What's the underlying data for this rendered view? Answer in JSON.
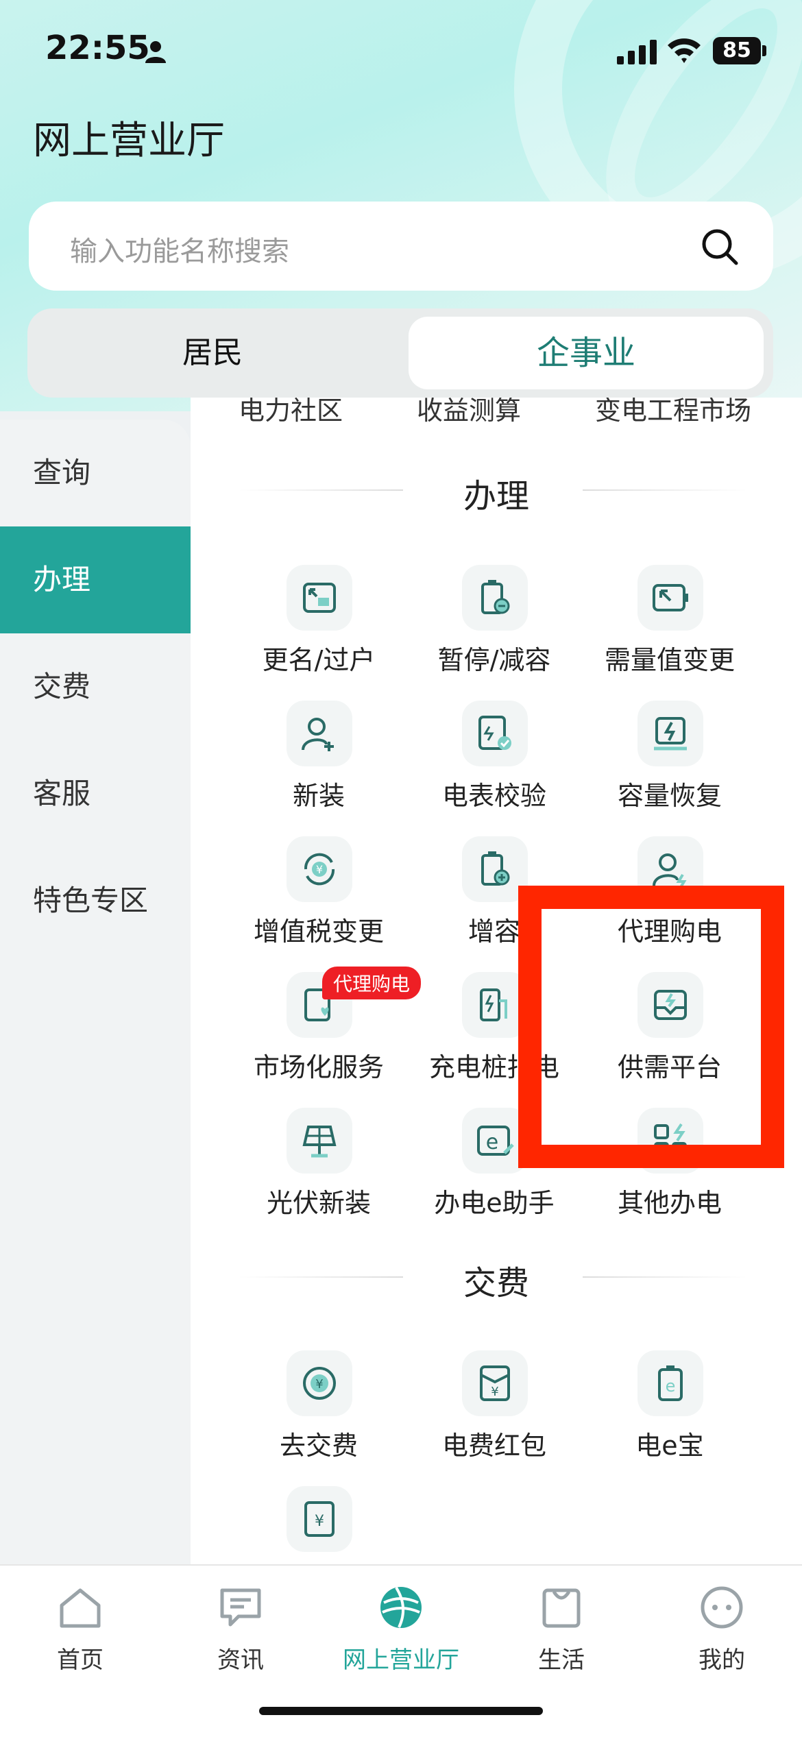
{
  "status": {
    "time": "22:55",
    "battery": "85"
  },
  "header": {
    "title": "网上营业厅"
  },
  "search": {
    "placeholder": "输入功能名称搜索"
  },
  "segment": {
    "left": "居民",
    "right": "企事业"
  },
  "sidebar": {
    "items": [
      {
        "label": "查询"
      },
      {
        "label": "办理"
      },
      {
        "label": "交费"
      },
      {
        "label": "客服"
      },
      {
        "label": "特色专区"
      }
    ],
    "active": "办理"
  },
  "content": {
    "cut_row": [
      "电力社区",
      "收益测算",
      "变电工程市场"
    ],
    "sections": [
      {
        "title": "办理",
        "items": [
          {
            "label": "更名/过户",
            "icon": "transfer-icon"
          },
          {
            "label": "暂停/减容",
            "icon": "pause-battery-icon"
          },
          {
            "label": "需量值变更",
            "icon": "demand-change-icon"
          },
          {
            "label": "新装",
            "icon": "new-user-icon"
          },
          {
            "label": "电表校验",
            "icon": "meter-check-icon"
          },
          {
            "label": "容量恢复",
            "icon": "capacity-restore-icon"
          },
          {
            "label": "增值税变更",
            "icon": "vat-change-icon"
          },
          {
            "label": "增容",
            "icon": "capacity-add-icon"
          },
          {
            "label": "代理购电",
            "icon": "proxy-purchase-icon"
          },
          {
            "label": "市场化服务",
            "icon": "market-service-icon",
            "badge": "代理购电"
          },
          {
            "label": "充电桩报电",
            "icon": "charging-pile-icon"
          },
          {
            "label": "供需平台",
            "icon": "supply-demand-icon"
          },
          {
            "label": "光伏新装",
            "icon": "solar-panel-icon"
          },
          {
            "label": "办电e助手",
            "icon": "e-assistant-icon"
          },
          {
            "label": "其他办电",
            "icon": "other-service-icon"
          }
        ]
      },
      {
        "title": "交费",
        "items": [
          {
            "label": "去交费",
            "icon": "yuan-coin-icon"
          },
          {
            "label": "电费红包",
            "icon": "red-packet-icon"
          },
          {
            "label": "电e宝",
            "icon": "e-wallet-icon"
          }
        ]
      }
    ]
  },
  "tabbar": {
    "items": [
      {
        "label": "首页",
        "icon": "home-icon"
      },
      {
        "label": "资讯",
        "icon": "news-icon"
      },
      {
        "label": "网上营业厅",
        "icon": "globe-icon"
      },
      {
        "label": "生活",
        "icon": "shopping-bag-icon"
      },
      {
        "label": "我的",
        "icon": "face-icon"
      }
    ],
    "active": "网上营业厅"
  },
  "colors": {
    "accent": "#23a59a",
    "highlight": "#ff2600",
    "badge": "#ee1f25"
  }
}
